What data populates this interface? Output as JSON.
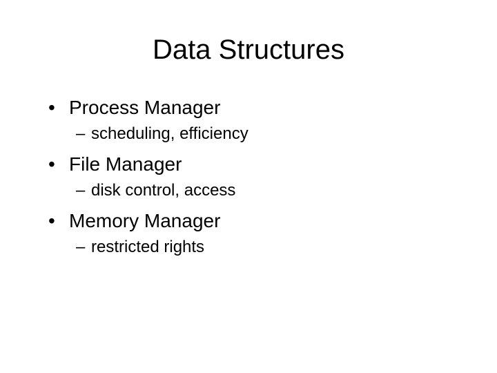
{
  "slide": {
    "title": "Data Structures",
    "items": [
      {
        "label": "Process Manager",
        "sub": "scheduling, efficiency"
      },
      {
        "label": "File Manager",
        "sub": "disk control, access"
      },
      {
        "label": "Memory Manager",
        "sub": "restricted rights"
      }
    ],
    "markers": {
      "l1": "•",
      "l2": "–"
    }
  }
}
